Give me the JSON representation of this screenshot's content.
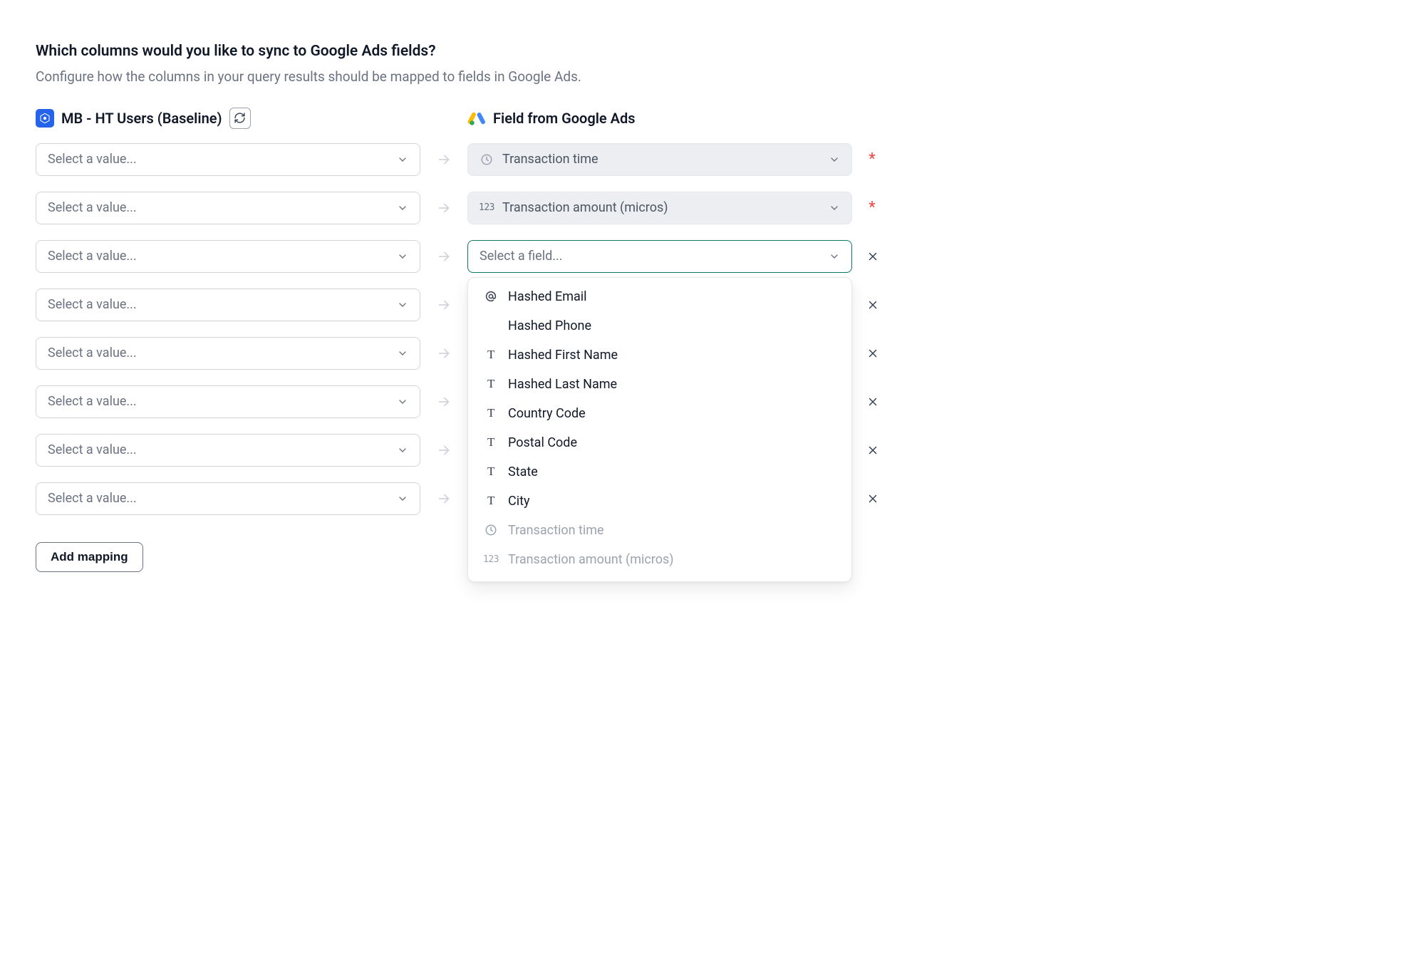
{
  "heading": "Which columns would you like to sync to Google Ads fields?",
  "subheading": "Configure how the columns in your query results should be mapped to fields in Google Ads.",
  "source": {
    "name": "MB - HT Users (Baseline)"
  },
  "destination": {
    "label": "Field from Google Ads"
  },
  "source_placeholder": "Select a value...",
  "dest_placeholder": "Select a field...",
  "rows": [
    {
      "dest_type": "clock",
      "dest_value": "Transaction time",
      "required": true,
      "filled": true
    },
    {
      "dest_type": "num",
      "dest_value": "Transaction amount (micros)",
      "required": true,
      "filled": true
    },
    {
      "open": true
    },
    {},
    {},
    {},
    {},
    {}
  ],
  "dropdown_options": [
    {
      "type": "at",
      "label": "Hashed Email"
    },
    {
      "type": "none",
      "label": "Hashed Phone"
    },
    {
      "type": "txt",
      "label": "Hashed First Name"
    },
    {
      "type": "txt",
      "label": "Hashed Last Name"
    },
    {
      "type": "txt",
      "label": "Country Code"
    },
    {
      "type": "txt",
      "label": "Postal Code"
    },
    {
      "type": "txt",
      "label": "State"
    },
    {
      "type": "txt",
      "label": "City"
    },
    {
      "type": "clock",
      "label": "Transaction time",
      "disabled": true
    },
    {
      "type": "num",
      "label": "Transaction amount (micros)",
      "disabled": true
    }
  ],
  "add_mapping_label": "Add mapping",
  "required_symbol": "*",
  "num_label": "123",
  "txt_label": "T"
}
